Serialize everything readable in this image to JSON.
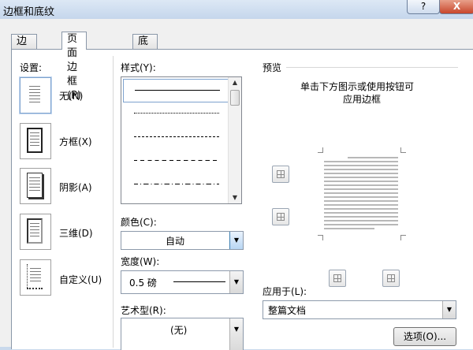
{
  "window": {
    "title": "边框和底纹",
    "help": "?",
    "close": "X"
  },
  "tabs": [
    {
      "label": "边框(B)"
    },
    {
      "label": "页面边框(P)"
    },
    {
      "label": "底纹(S)"
    }
  ],
  "settings": {
    "label": "设置:",
    "items": [
      {
        "label": "无(N)"
      },
      {
        "label": "方框(X)"
      },
      {
        "label": "阴影(A)"
      },
      {
        "label": "三维(D)"
      },
      {
        "label": "自定义(U)"
      }
    ]
  },
  "style": {
    "label": "样式(Y):"
  },
  "color": {
    "label": "颜色(C):",
    "value": "自动"
  },
  "width": {
    "label": "宽度(W):",
    "value": "0.5 磅"
  },
  "art": {
    "label": "艺术型(R):",
    "value": "(无)"
  },
  "preview": {
    "label": "预览",
    "hint_line1": "单击下方图示或使用按钮可",
    "hint_line2": "应用边框"
  },
  "apply": {
    "label": "应用于(L):",
    "value": "整篇文档"
  },
  "options_button": "选项(O)...",
  "colors": {
    "accent": "#3c7fb1",
    "title_bar": "#c9d9ec",
    "close": "#c8462c"
  }
}
